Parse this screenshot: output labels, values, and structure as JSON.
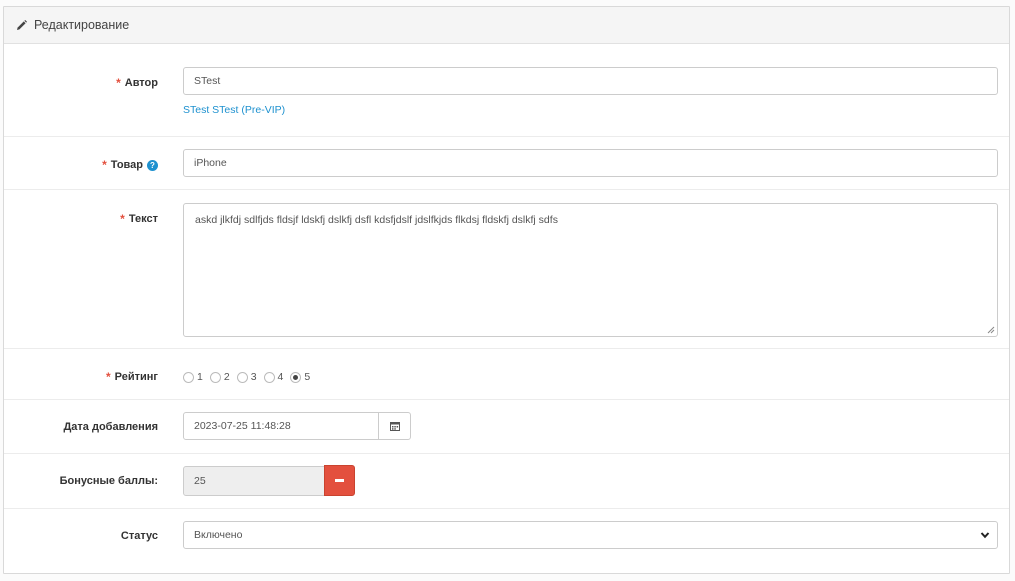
{
  "panel": {
    "title": "Редактирование"
  },
  "author": {
    "label": "Автор",
    "value": "STest",
    "link_text": "STest STest (Pre-VIP)"
  },
  "product": {
    "label": "Товар",
    "value": "iPhone"
  },
  "text": {
    "label": "Текст",
    "value": "askd jlkfdj sdlfjds fldsjf ldskfj dslkfj dsfl kdsfjdslf jdslfkjds flkdsj fldskfj dslkfj sdfs"
  },
  "rating": {
    "label": "Рейтинг",
    "options": [
      "1",
      "2",
      "3",
      "4",
      "5"
    ],
    "selected": "5"
  },
  "date_added": {
    "label": "Дата добавления",
    "value": "2023-07-25 11:48:28"
  },
  "bonus": {
    "label": "Бонусные баллы:",
    "value": "25"
  },
  "status": {
    "label": "Статус",
    "value": "Включено"
  },
  "icons": {
    "heading": "pencil-icon",
    "help": "question-circle-icon",
    "calendar": "calendar-icon",
    "remove": "minus-icon",
    "select": "chevron-down-icon"
  },
  "colors": {
    "required": "#e3503e",
    "link": "#1e91cf",
    "danger": "#e3503e"
  }
}
